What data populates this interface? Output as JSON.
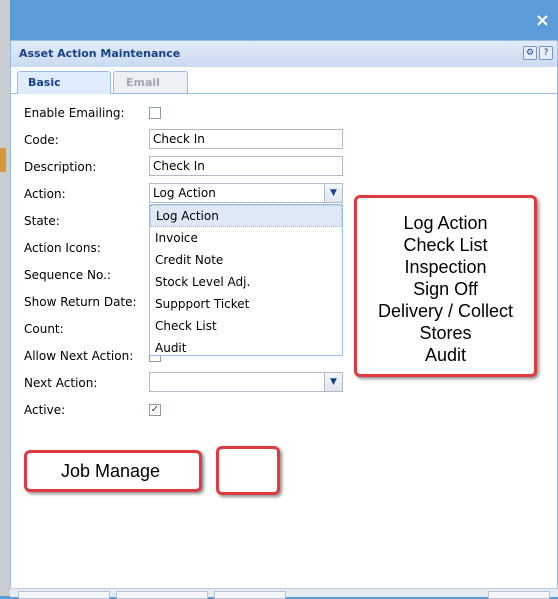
{
  "window": {
    "close_glyph": "×"
  },
  "panel": {
    "title": "Asset Action Maintenance",
    "tool_icons": [
      "gear-icon",
      "help-icon"
    ],
    "tool_glyphs": [
      "⚙",
      "?"
    ]
  },
  "tabs": [
    {
      "label": "Basic",
      "active": true
    },
    {
      "label": "Email",
      "active": false
    }
  ],
  "form": {
    "enable_emailing": {
      "label": "Enable Emailing:",
      "checked": false
    },
    "code": {
      "label": "Code:",
      "value": "Check In"
    },
    "description": {
      "label": "Description:",
      "value": "Check In"
    },
    "action": {
      "label": "Action:",
      "value": "Log Action"
    },
    "state": {
      "label": "State:"
    },
    "action_icons": {
      "label": "Action Icons:"
    },
    "sequence_no": {
      "label": "Sequence No.:"
    },
    "show_return_date": {
      "label": "Show Return Date:"
    },
    "count": {
      "label": "Count:"
    },
    "allow_next_action": {
      "label": "Allow Next Action:"
    },
    "next_action": {
      "label": "Next Action:",
      "value": ""
    },
    "active": {
      "label": "Active:",
      "checked": true,
      "check_glyph": "✓"
    }
  },
  "action_dropdown": {
    "options": [
      "Log Action",
      "Invoice",
      "Credit Note",
      "Stock Level Adj.",
      "Suppport Ticket",
      "Check List",
      "Audit"
    ],
    "selected": "Log Action"
  },
  "annotations": {
    "list_callout": [
      "Log Action",
      "Check List",
      "Inspection",
      "Sign Off",
      "Delivery / Collect",
      "Stores",
      "Audit"
    ],
    "job_manage_label": "Job Manage",
    "border_color": "#e0393f"
  },
  "colors": {
    "background": "#5a9bd8",
    "header_text": "#15428b",
    "panel_border": "#99bbe8"
  }
}
